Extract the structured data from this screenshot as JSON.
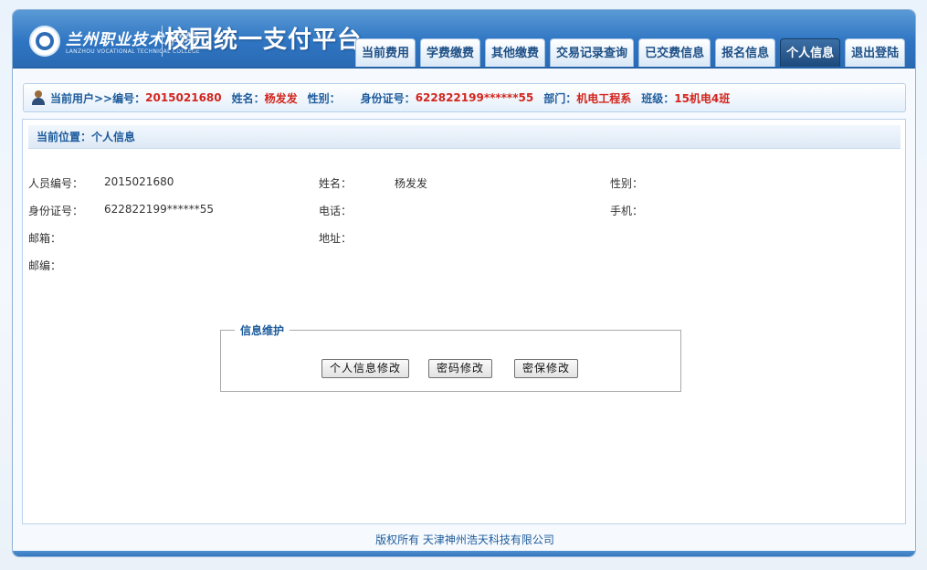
{
  "header": {
    "logo_cn": "兰州职业技术学院",
    "logo_en": "LANZHOU VOCATIONAL TECHNICAL COLLEGE",
    "app_title": "校园统一支付平台",
    "brand_color": "#2f75c2"
  },
  "nav": {
    "tabs": [
      {
        "label": "当前费用",
        "active": false
      },
      {
        "label": "学费缴费",
        "active": false
      },
      {
        "label": "其他缴费",
        "active": false
      },
      {
        "label": "交易记录查询",
        "active": false
      },
      {
        "label": "已交费信息",
        "active": false
      },
      {
        "label": "报名信息",
        "active": false
      },
      {
        "label": "个人信息",
        "active": true
      },
      {
        "label": "退出登陆",
        "active": false
      }
    ]
  },
  "userbar": {
    "prefix": "当前用户>>编号：",
    "id": "2015021680",
    "name_label": "姓名：",
    "name": "杨发发",
    "gender_label": "性别：",
    "gender": "",
    "idcard_label": "身份证号：",
    "idcard": "622822199******55",
    "dept_label": "部门：",
    "dept": "机电工程系",
    "class_label": "班级：",
    "class": "15机电4班"
  },
  "location": {
    "text": "当前位置：个人信息"
  },
  "info": {
    "staff_no_label": "人员编号：",
    "staff_no": "2015021680",
    "name_label": "姓名：",
    "name": "杨发发",
    "gender_label": "性别：",
    "gender": "",
    "idcard_label": "身份证号：",
    "idcard": "622822199******55",
    "phone_label": "电话：",
    "phone": "",
    "mobile_label": "手机：",
    "mobile": "",
    "email_label": "邮箱：",
    "email": "",
    "address_label": "地址：",
    "address": "",
    "zip_label": "邮编：",
    "zip": ""
  },
  "maintenance": {
    "legend": "信息维护",
    "btn_profile": "个人信息修改",
    "btn_password": "密码修改",
    "btn_security": "密保修改"
  },
  "footer": {
    "text": "版权所有  天津神州浩天科技有限公司"
  }
}
